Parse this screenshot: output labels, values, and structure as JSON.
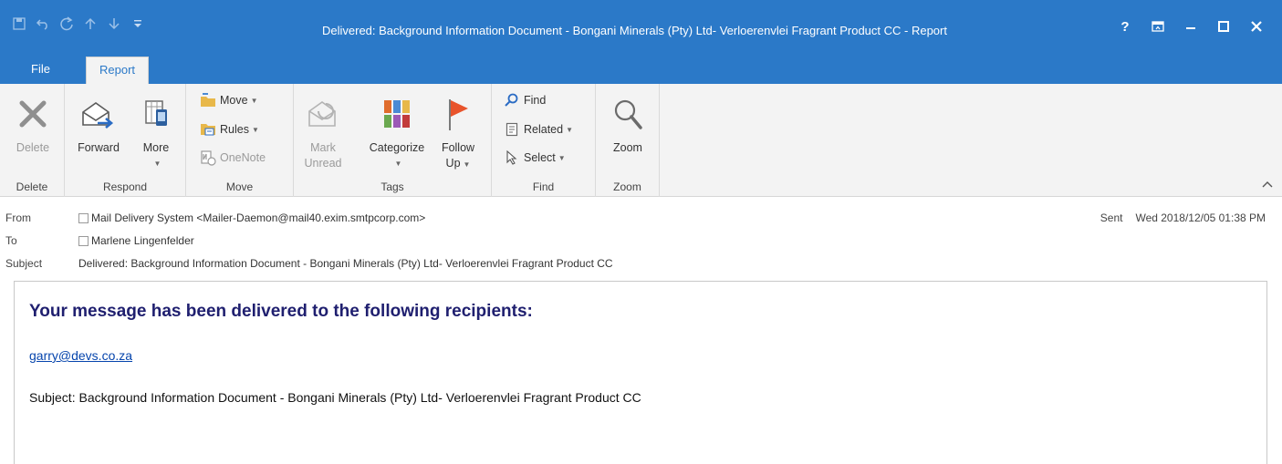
{
  "window": {
    "title": "Delivered: Background Information Document - Bongani Minerals (Pty) Ltd- Verloerenvlei Fragrant Product CC - Report",
    "qat_icons": [
      "save-icon",
      "undo-icon",
      "redo-icon",
      "up-arrow-icon",
      "down-arrow-icon",
      "customize-qat-icon"
    ],
    "controls": [
      "help-icon",
      "ribbon-display-icon",
      "minimize-icon",
      "maximize-icon",
      "close-icon"
    ],
    "help_glyph": "?",
    "colors": {
      "titlebar": "#2b79c8",
      "ribbon": "#f3f3f3",
      "heading": "#1f1f6f",
      "link": "#0645ad"
    }
  },
  "tabs": [
    {
      "label": "File",
      "active": false
    },
    {
      "label": "Report",
      "active": true
    }
  ],
  "ribbon": {
    "delete_group": {
      "label": "Delete",
      "delete_button": "Delete"
    },
    "respond_group": {
      "label": "Respond",
      "forward_button": "Forward",
      "more_button": "More"
    },
    "move_group": {
      "label": "Move",
      "move_button": "Move",
      "rules_button": "Rules",
      "onenote_button": "OneNote"
    },
    "tags_group": {
      "label": "Tags",
      "mark_unread_line1": "Mark",
      "mark_unread_line2": "Unread",
      "categorize_button": "Categorize",
      "followup_line1": "Follow",
      "followup_line2": "Up"
    },
    "find_group": {
      "label": "Find",
      "find_button": "Find",
      "related_button": "Related",
      "select_button": "Select"
    },
    "zoom_group": {
      "label": "Zoom",
      "zoom_button": "Zoom"
    }
  },
  "header": {
    "from_label": "From",
    "from_value": "Mail Delivery System <Mailer-Daemon@mail40.exim.smtpcorp.com>",
    "to_label": "To",
    "to_value": "Marlene Lingenfelder",
    "subject_label": "Subject",
    "subject_value": "Delivered: Background Information Document - Bongani Minerals (Pty) Ltd- Verloerenvlei Fragrant Product CC",
    "sent_label": "Sent",
    "sent_value": "Wed 2018/12/05 01:38 PM"
  },
  "message": {
    "heading": "Your message has been delivered to the following recipients:",
    "recipient": "garry@devs.co.za",
    "subject_line": "Subject: Background Information Document - Bongani Minerals (Pty) Ltd- Verloerenvlei Fragrant Product CC"
  }
}
